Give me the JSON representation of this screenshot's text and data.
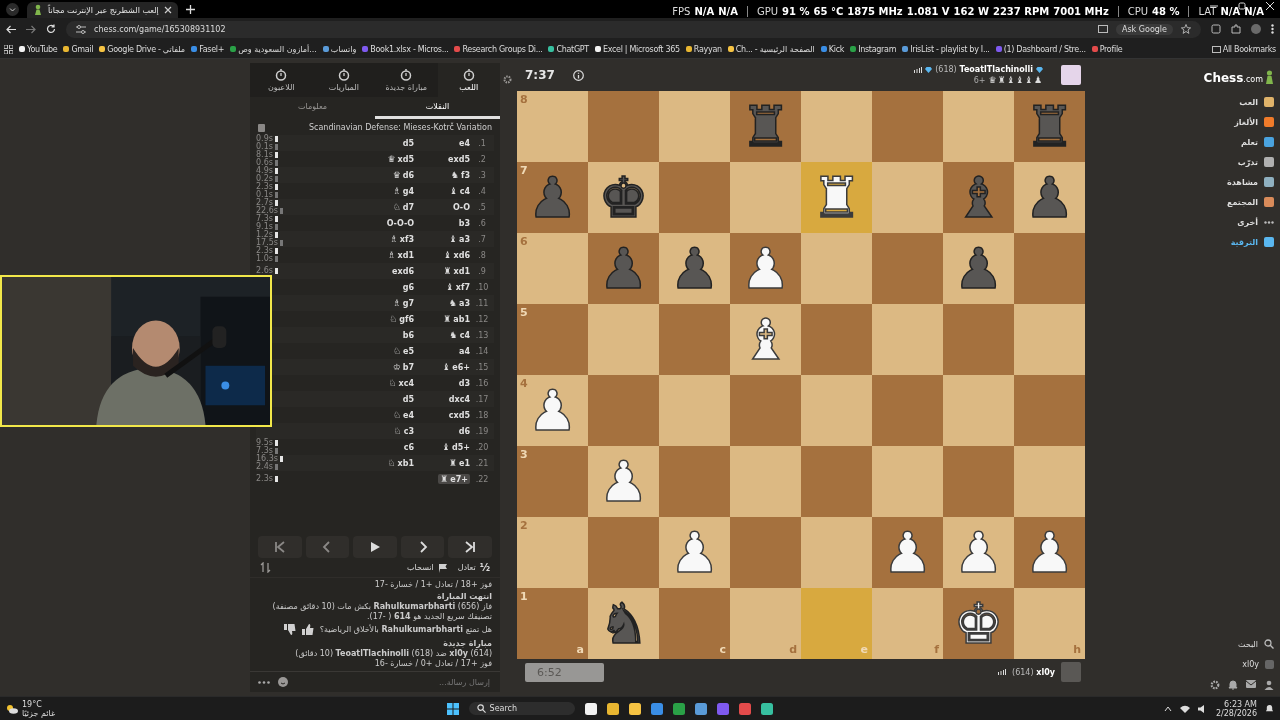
{
  "browser": {
    "tab_title": "إلعب الشطرنج عبر الإنترنت مجاناً",
    "url": "chess.com/game/165308931102",
    "ask": "Ask Google",
    "bookmarks": [
      "YouTube",
      "Gmail",
      "Google Drive - ملفاتي",
      "Fasel+",
      "أمازون السعودية وص...",
      "واتساب",
      "Book1.xlsx - Micros...",
      "Research Groups Di...",
      "ChatGPT",
      "Excel | Microsoft 365",
      "Rayyan",
      "Ch... - الصفحة الرئيسية",
      "Kick",
      "Instagram",
      "IrisList - playlist by I...",
      "(1) Dashboard / Stre...",
      "Profile"
    ],
    "all_bookmarks": "All Bookmarks"
  },
  "overlay": [
    {
      "label": "FPS",
      "values": [
        "N/A",
        "N/A"
      ]
    },
    {
      "label": "GPU",
      "values": [
        "91 %",
        "65 °C",
        "1875 MHz",
        "1.081 V",
        "162 W",
        "2237 RPM",
        "7001 MHz"
      ]
    },
    {
      "label": "CPU",
      "values": [
        "48 %"
      ]
    },
    {
      "label": "LAT",
      "values": [
        "N/A",
        "N/A"
      ]
    }
  ],
  "panel": {
    "tabs": [
      {
        "label": "اللعب",
        "selected": true
      },
      {
        "label": "مباراة جديدة",
        "selected": false
      },
      {
        "label": "المباريات",
        "selected": false
      },
      {
        "label": "اللاعبون",
        "selected": false
      }
    ],
    "subtabs": [
      {
        "label": "النقلات",
        "selected": true
      },
      {
        "label": "معلومات",
        "selected": false
      }
    ],
    "opening": "Scandinavian Defense: Mieses-Kotrč Variation",
    "moves": [
      {
        "number": "1.",
        "white": "e4",
        "black": "d5",
        "times": [
          "0.9s",
          "0.1s"
        ],
        "selected": false
      },
      {
        "number": "2.",
        "white": "exd5",
        "black": "xd5",
        "black_piece": "♛",
        "times": [
          "8.1s",
          "0.6s"
        ],
        "selected": false
      },
      {
        "number": "3.",
        "white": "f3",
        "white_piece": "♞",
        "black": "d6",
        "black_piece": "♛",
        "times": [
          "4.9s",
          "0.2s"
        ],
        "selected": false
      },
      {
        "number": "4.",
        "white": "c4",
        "white_piece": "♝",
        "black": "g4",
        "black_piece": "♗",
        "times": [
          "2.3s",
          "0.1s"
        ],
        "selected": false
      },
      {
        "number": "5.",
        "white": "O-O",
        "black": "d7",
        "black_piece": "♘",
        "times": [
          "2.7s",
          "22.6s"
        ],
        "selected": false
      },
      {
        "number": "6.",
        "white": "b3",
        "black": "O-O-O",
        "times": [
          "7.3s",
          "9.1s"
        ],
        "selected": false
      },
      {
        "number": "7.",
        "white": "a3",
        "white_piece": "♝",
        "black": "xf3",
        "black_piece": "♗",
        "times": [
          "1.2s",
          "17.5s"
        ],
        "selected": false
      },
      {
        "number": "8.",
        "white": "xd6",
        "white_piece": "♝",
        "black": "xd1",
        "black_piece": "♗",
        "times": [
          "2.3s",
          "1.0s"
        ],
        "selected": false
      },
      {
        "number": "9.",
        "white": "xd1",
        "white_piece": "♜",
        "black": "exd6",
        "times": [
          "2.6s"
        ],
        "selected": false
      },
      {
        "number": "10.",
        "white": "xf7",
        "white_piece": "♝",
        "black": "g6",
        "selected": false
      },
      {
        "number": "11.",
        "white": "a3",
        "white_piece": "♞",
        "black": "g7",
        "black_piece": "♗",
        "selected": false
      },
      {
        "number": "12.",
        "white": "ab1",
        "white_piece": "♜",
        "black": "gf6",
        "black_piece": "♘",
        "selected": false
      },
      {
        "number": "13.",
        "white": "c4",
        "white_piece": "♞",
        "black": "b6",
        "selected": false
      },
      {
        "number": "14.",
        "white": "a4",
        "black": "e5",
        "black_piece": "♘",
        "selected": false
      },
      {
        "number": "15.",
        "white": "+e6",
        "white_piece": "♝",
        "black": "b7",
        "black_piece": "♔",
        "selected": false
      },
      {
        "number": "16.",
        "white": "d3",
        "black": "xc4",
        "black_piece": "♘",
        "selected": false
      },
      {
        "number": "17.",
        "white": "dxc4",
        "black": "d5",
        "selected": false
      },
      {
        "number": "18.",
        "white": "cxd5",
        "black": "e4",
        "black_piece": "♘",
        "selected": false
      },
      {
        "number": "19.",
        "white": "d6",
        "black": "c3",
        "black_piece": "♘",
        "selected": false
      },
      {
        "number": "20.",
        "white": "+d5",
        "white_piece": "♝",
        "black": "c6",
        "times": [
          "9.5s",
          "7.3s"
        ],
        "selected": false
      },
      {
        "number": "21.",
        "white": "e1",
        "white_piece": "♜",
        "black": "xb1",
        "black_piece": "♘",
        "times": [
          "16.3s",
          "2.4s"
        ],
        "selected": false
      },
      {
        "number": "22.",
        "white": "+e7",
        "white_piece": "♜",
        "times": [
          "2.3s"
        ],
        "selected": true
      }
    ],
    "draw": {
      "icon": "½",
      "label": "تعادل"
    },
    "resign": "انسحاب",
    "chat": [
      {
        "kind": "text",
        "text": "فوز +18 / تعادل +1 / خسارة -17"
      },
      {
        "kind": "heading",
        "text": "انتهت المباراة"
      },
      {
        "kind": "text",
        "text": "فاز (656) **Rahulkumarbharti** بكش مات (10 دقائق مصنفة)"
      },
      {
        "kind": "text",
        "text": "تصنيفك سريع الجديد هو **614** ( -17)."
      },
      {
        "kind": "feedback",
        "text": "هل تمتع **Rahulkumarbharti** بالأخلاق الرياضية؟"
      },
      {
        "kind": "heading",
        "text": "مباراة جديدة"
      },
      {
        "kind": "text",
        "text": "(614) **xl0y** ضد (618) **TeoatlTlachinolli** (10 دقائق)"
      },
      {
        "kind": "text",
        "text": "فوز +17 / تعادل +0 / خسارة -16"
      }
    ],
    "message_placeholder": "إرسال رسالة..."
  },
  "top_player": {
    "clock": "7:37",
    "rating": "(618)",
    "name": "TeoatlTlachinolli",
    "captured": "♛♜♝♝♝♟",
    "advantage": "6+"
  },
  "bottom_player": {
    "clock": "6:52",
    "rating": "(614)",
    "name": "xl0y"
  },
  "board": [
    {
      "rank": "8",
      "squares": [
        {
          "highlight": false
        },
        {
          "highlight": false
        },
        {
          "highlight": false
        },
        {
          "piece": "♜",
          "white": false,
          "highlight": false
        },
        {
          "highlight": false
        },
        {
          "highlight": false
        },
        {
          "highlight": false
        },
        {
          "piece": "♜",
          "white": false,
          "highlight": false
        }
      ]
    },
    {
      "rank": "7",
      "squares": [
        {
          "piece": "♟",
          "white": false,
          "highlight": false
        },
        {
          "piece": "♚",
          "white": false,
          "highlight": false
        },
        {
          "highlight": false
        },
        {
          "highlight": false
        },
        {
          "piece": "♜",
          "white": true,
          "highlight": true
        },
        {
          "highlight": false
        },
        {
          "piece": "♝",
          "white": false,
          "highlight": false
        },
        {
          "piece": "♟",
          "white": false,
          "highlight": false
        }
      ]
    },
    {
      "rank": "6",
      "squares": [
        {
          "highlight": false
        },
        {
          "piece": "♟",
          "white": false,
          "highlight": false
        },
        {
          "piece": "♟",
          "white": false,
          "highlight": false
        },
        {
          "piece": "♟",
          "white": true,
          "highlight": false
        },
        {
          "highlight": false
        },
        {
          "highlight": false
        },
        {
          "piece": "♟",
          "white": false,
          "highlight": false
        },
        {
          "highlight": false
        }
      ]
    },
    {
      "rank": "5",
      "squares": [
        {
          "highlight": false
        },
        {
          "highlight": false
        },
        {
          "highlight": false
        },
        {
          "piece": "♝",
          "white": true,
          "highlight": false
        },
        {
          "highlight": false
        },
        {
          "highlight": false
        },
        {
          "highlight": false
        },
        {
          "highlight": false
        }
      ]
    },
    {
      "rank": "4",
      "squares": [
        {
          "piece": "♟",
          "white": true,
          "highlight": false
        },
        {
          "highlight": false
        },
        {
          "highlight": false
        },
        {
          "highlight": false
        },
        {
          "highlight": false
        },
        {
          "highlight": false
        },
        {
          "highlight": false
        },
        {
          "highlight": false
        }
      ]
    },
    {
      "rank": "3",
      "squares": [
        {
          "highlight": false
        },
        {
          "piece": "♟",
          "white": true,
          "highlight": false
        },
        {
          "highlight": false
        },
        {
          "highlight": false
        },
        {
          "highlight": false
        },
        {
          "highlight": false
        },
        {
          "highlight": false
        },
        {
          "highlight": false
        }
      ]
    },
    {
      "rank": "2",
      "squares": [
        {
          "highlight": false
        },
        {
          "highlight": false
        },
        {
          "piece": "♟",
          "white": true,
          "highlight": false
        },
        {
          "highlight": false
        },
        {
          "highlight": false
        },
        {
          "piece": "♟",
          "white": true,
          "highlight": false
        },
        {
          "piece": "♟",
          "white": true,
          "highlight": false
        },
        {
          "piece": "♟",
          "white": true,
          "highlight": false
        }
      ]
    },
    {
      "rank": "1",
      "squares": [
        {
          "file": "a",
          "highlight": false
        },
        {
          "piece": "♞",
          "white": false,
          "highlight": false
        },
        {
          "file": "c",
          "highlight": false
        },
        {
          "file": "d",
          "highlight": false
        },
        {
          "file": "e",
          "highlight": true
        },
        {
          "file": "f",
          "highlight": false
        },
        {
          "piece": "♚",
          "white": true,
          "highlight": false
        },
        {
          "file": "h",
          "highlight": false
        }
      ]
    }
  ],
  "sidebar": {
    "logo": "Chess",
    "logo_suffix": ".com",
    "items": [
      {
        "label": "العب",
        "kind": "link"
      },
      {
        "label": "الألغاز",
        "kind": "link"
      },
      {
        "label": "تعلم",
        "kind": "link"
      },
      {
        "label": "تدرّب",
        "kind": "link"
      },
      {
        "label": "مشاهدة",
        "kind": "link"
      },
      {
        "label": "المجتمع",
        "kind": "link"
      },
      {
        "label": "أخرى",
        "kind": "more"
      },
      {
        "label": "الترقية",
        "kind": "upgrade"
      }
    ],
    "search": "البحث",
    "user": "xl0y"
  },
  "taskbar": {
    "temp": "19°C",
    "weather": "غائم جزئيًا",
    "search": "Search",
    "time": "6:23 AM",
    "date": "2/28/2026"
  }
}
